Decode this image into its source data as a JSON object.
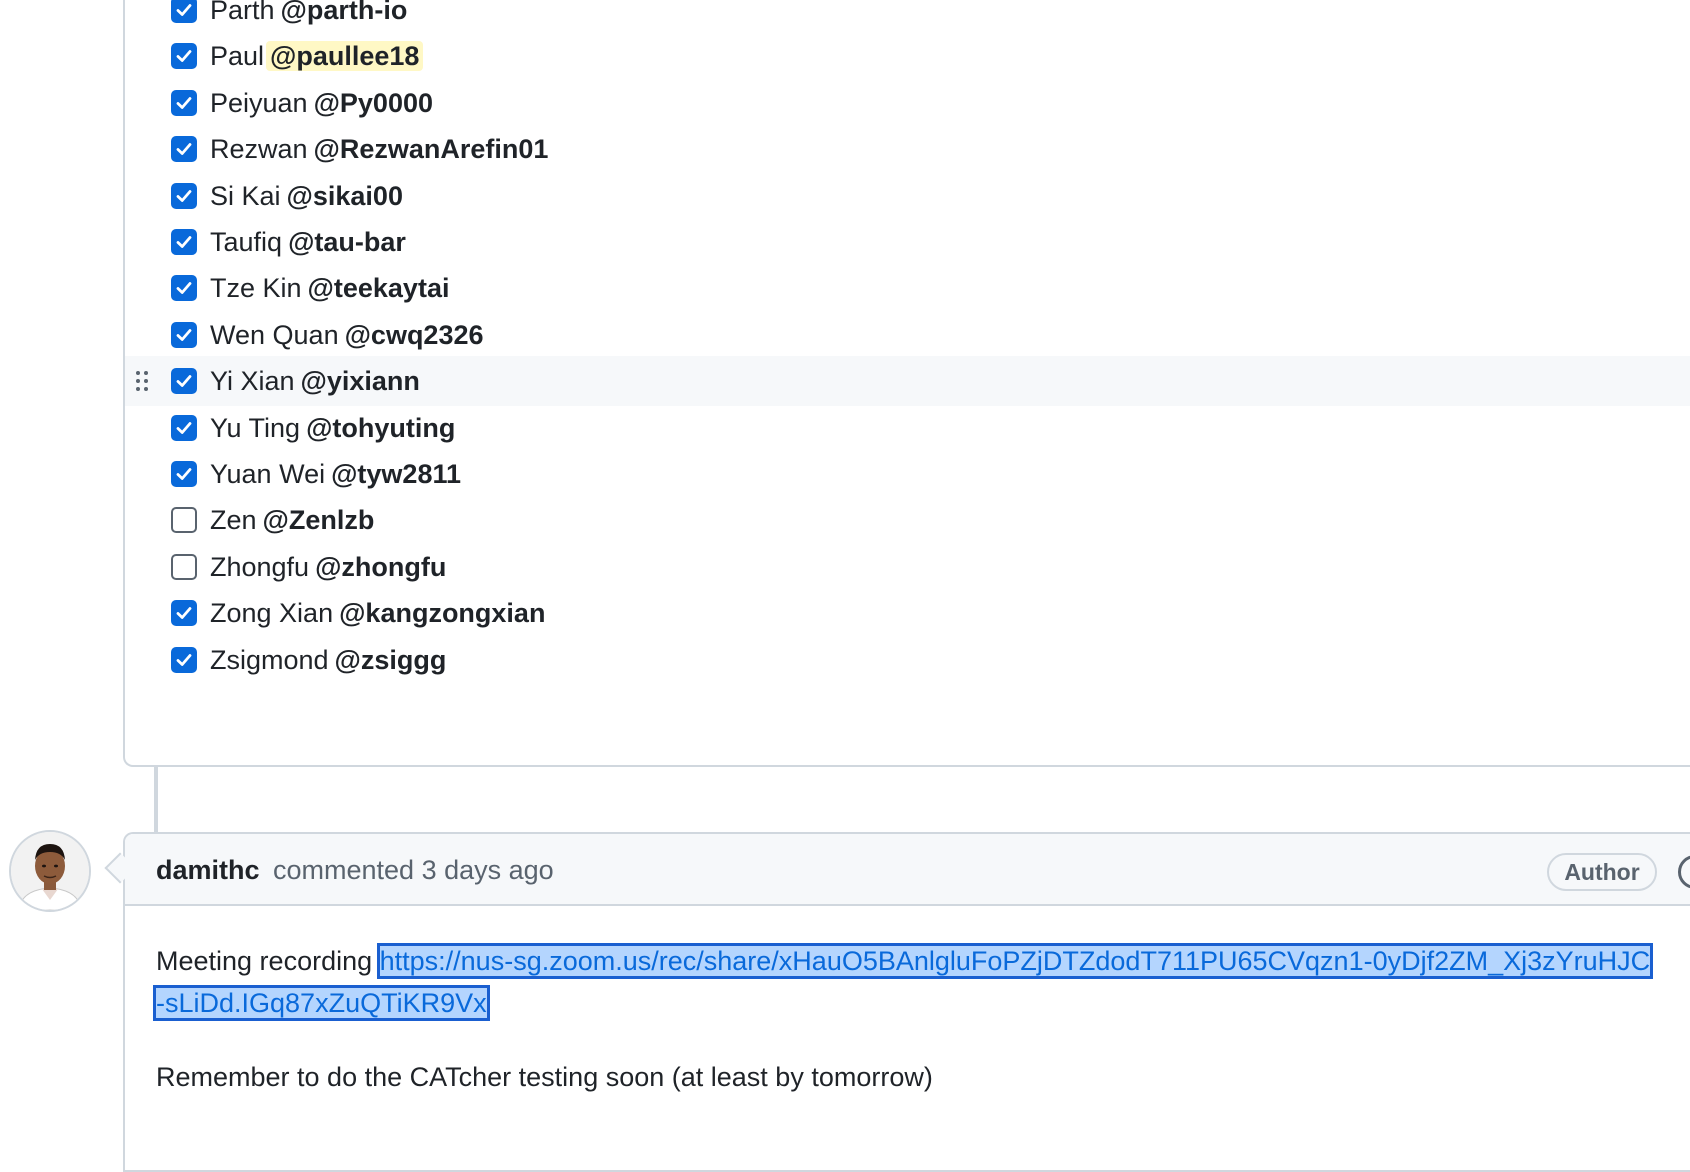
{
  "task_list": {
    "items": [
      {
        "name": "Parth",
        "handle": "@parth-io",
        "checked": true,
        "highlight": false,
        "hovered": false
      },
      {
        "name": "Paul",
        "handle": "@paullee18",
        "checked": true,
        "highlight": true,
        "hovered": false
      },
      {
        "name": "Peiyuan",
        "handle": "@Py0000",
        "checked": true,
        "highlight": false,
        "hovered": false
      },
      {
        "name": "Rezwan",
        "handle": "@RezwanArefin01",
        "checked": true,
        "highlight": false,
        "hovered": false
      },
      {
        "name": "Si Kai",
        "handle": "@sikai00",
        "checked": true,
        "highlight": false,
        "hovered": false
      },
      {
        "name": "Taufiq",
        "handle": "@tau-bar",
        "checked": true,
        "highlight": false,
        "hovered": false
      },
      {
        "name": "Tze Kin",
        "handle": "@teekaytai",
        "checked": true,
        "highlight": false,
        "hovered": false
      },
      {
        "name": "Wen Quan",
        "handle": "@cwq2326",
        "checked": true,
        "highlight": false,
        "hovered": false
      },
      {
        "name": "Yi Xian",
        "handle": "@yixiann",
        "checked": true,
        "highlight": false,
        "hovered": true
      },
      {
        "name": "Yu Ting",
        "handle": "@tohyuting",
        "checked": true,
        "highlight": false,
        "hovered": false
      },
      {
        "name": "Yuan Wei",
        "handle": "@tyw2811",
        "checked": true,
        "highlight": false,
        "hovered": false
      },
      {
        "name": "Zen",
        "handle": "@Zenlzb",
        "checked": false,
        "highlight": false,
        "hovered": false
      },
      {
        "name": "Zhongfu",
        "handle": "@zhongfu",
        "checked": false,
        "highlight": false,
        "hovered": false
      },
      {
        "name": "Zong Xian",
        "handle": "@kangzongxian",
        "checked": true,
        "highlight": false,
        "hovered": false
      },
      {
        "name": "Zsigmond",
        "handle": "@zsiggg",
        "checked": true,
        "highlight": false,
        "hovered": false
      }
    ]
  },
  "comment": {
    "author": "damithc",
    "meta": "commented 3 days ago",
    "badge": "Author",
    "body_prefix": "Meeting recording ",
    "link": "https://nus-sg.zoom.us/rec/share/xHauO5BAnlgluFoPZjDTZdodT711PU65CVqzn1-0yDjf2ZM_Xj3zYruHJC-sLiDd.IGq87xZuQTiKR9Vx",
    "body_second": "Remember to do the CATcher testing soon (at least by tomorrow)"
  },
  "icons": {
    "checkbox_checked": "checkbox-checked-icon",
    "checkbox_unchecked": "checkbox-unchecked-icon",
    "drag_handle": "grabber-icon",
    "more": "kebab-horizontal-icon"
  },
  "colors": {
    "accent": "#0969da",
    "border": "#d0d7de",
    "muted": "#59636e",
    "mention_highlight": "#fff8c5",
    "selection": "#b4d5fe"
  }
}
